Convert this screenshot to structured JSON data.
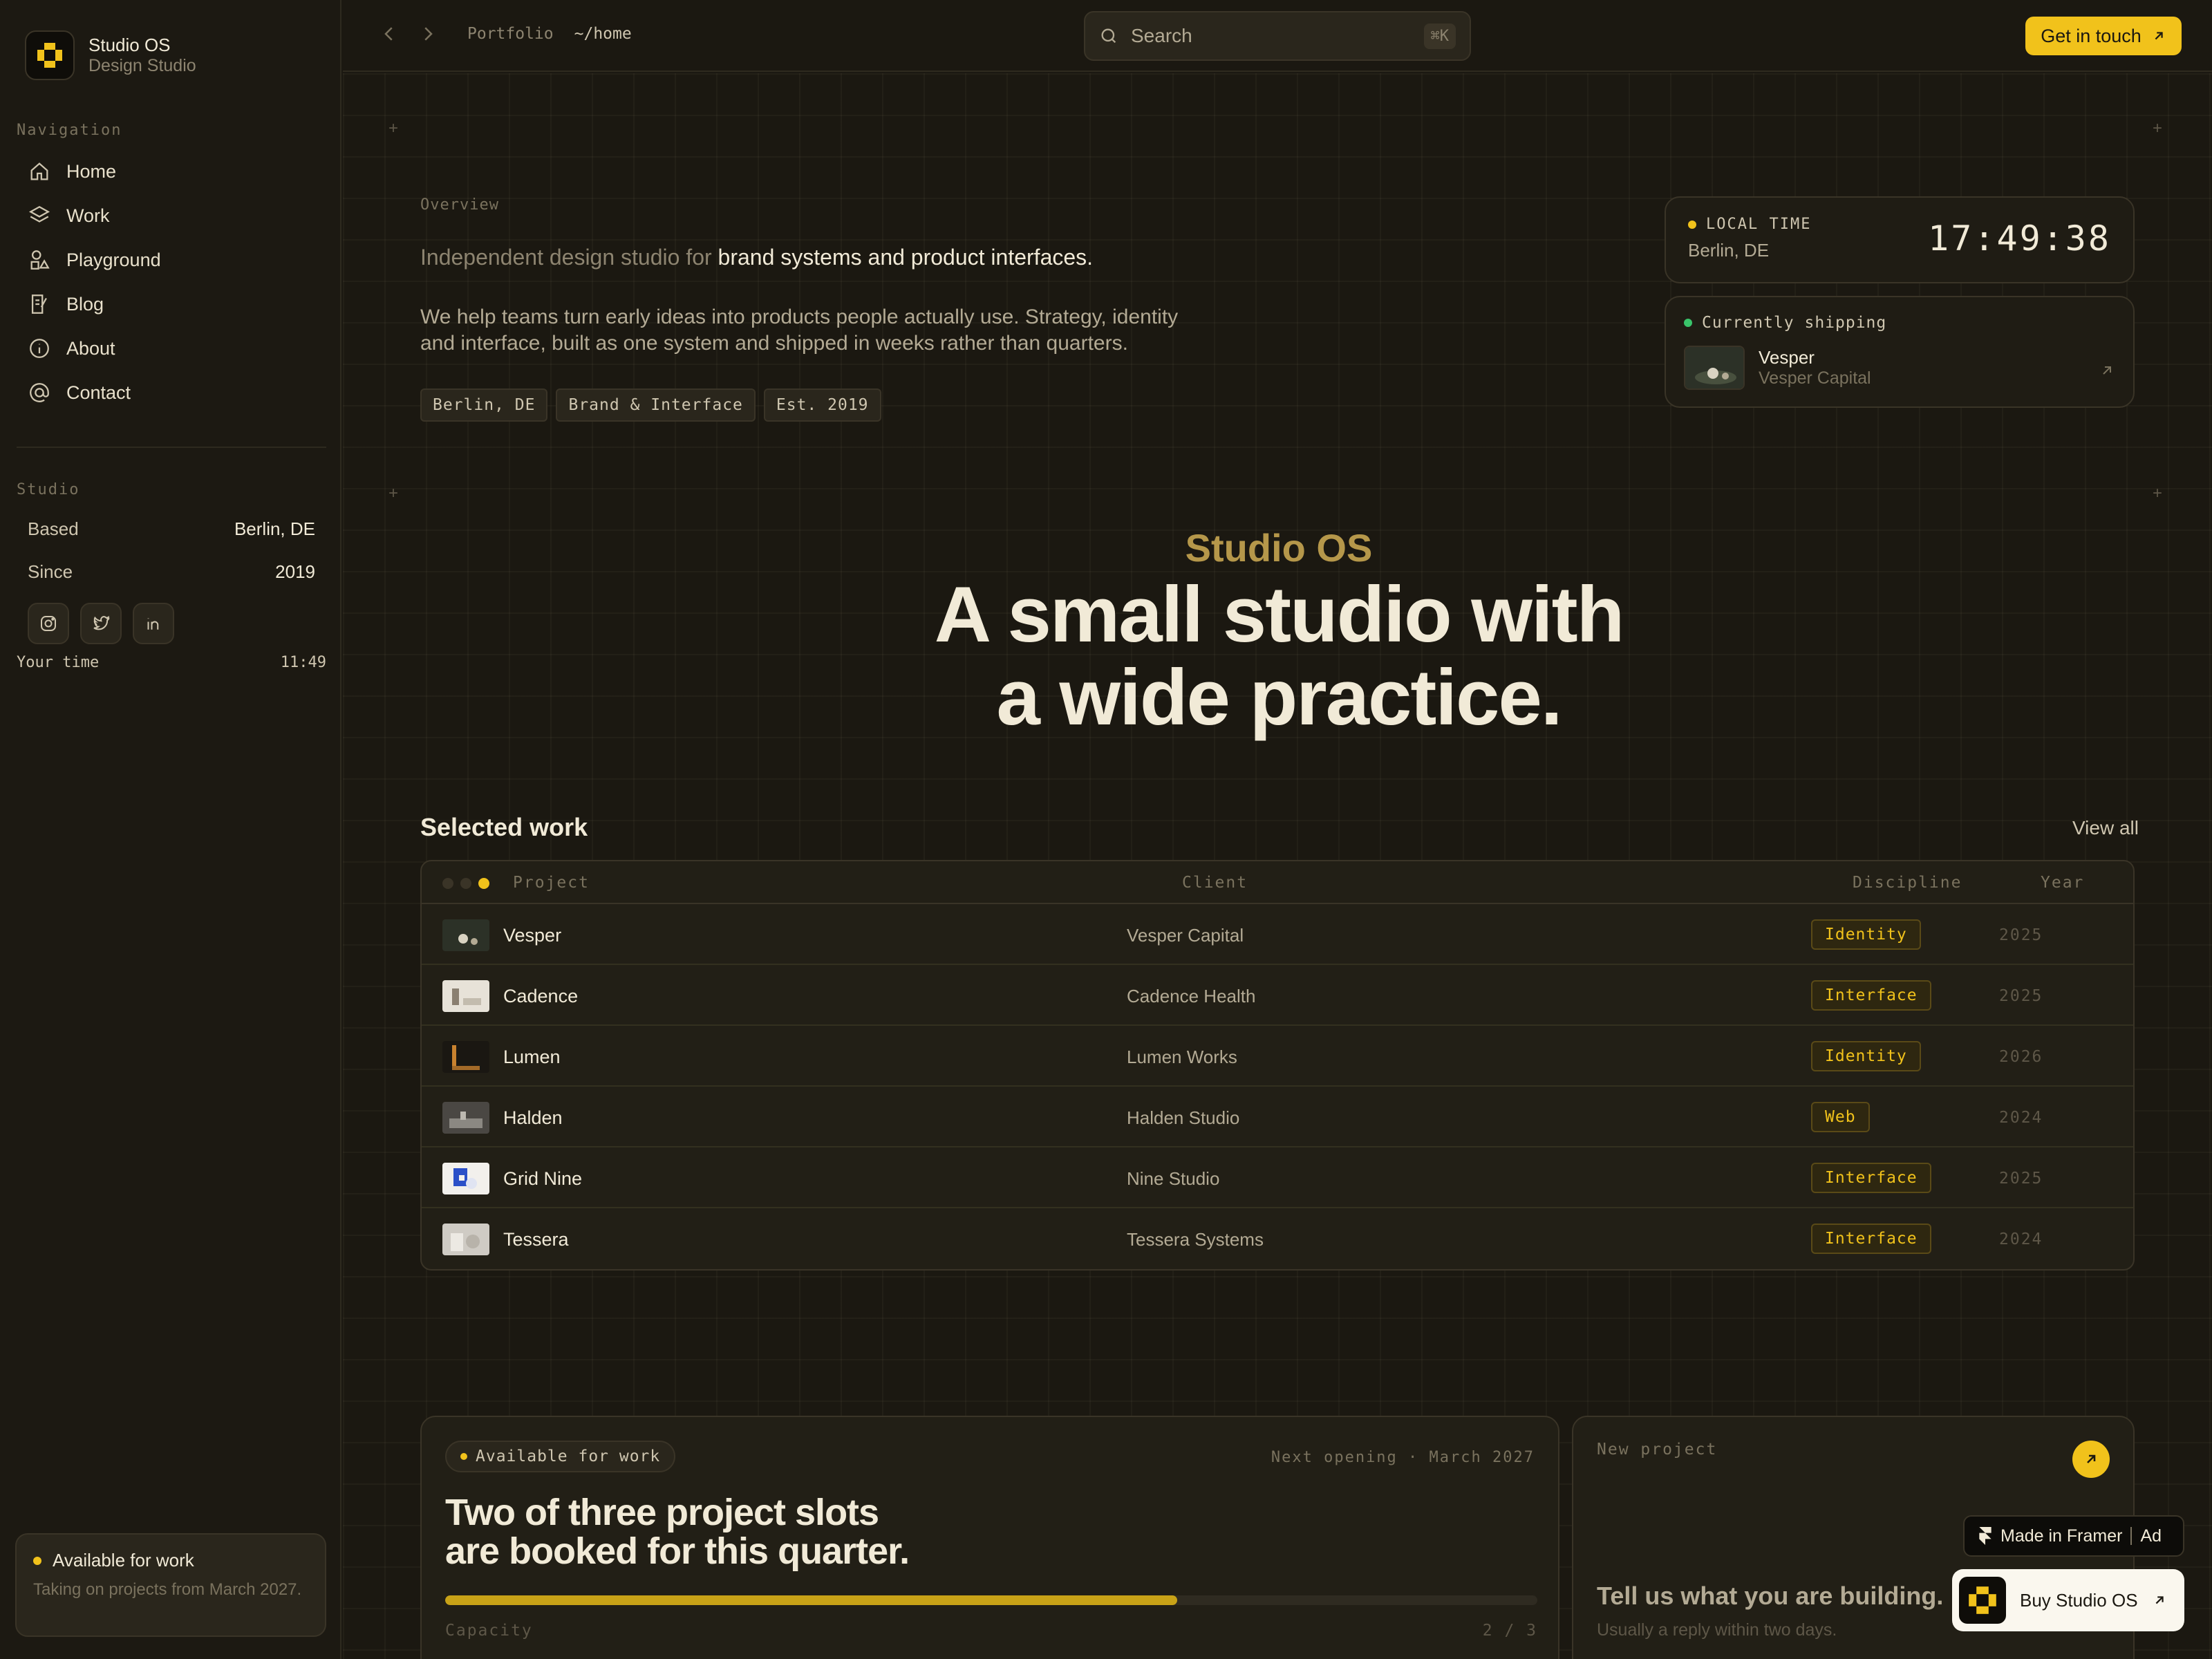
{
  "brand": {
    "name": "Studio OS",
    "subtitle": "Design Studio"
  },
  "sidebar": {
    "nav_label": "Navigation",
    "items": [
      {
        "label": "Home",
        "icon": "home-icon"
      },
      {
        "label": "Work",
        "icon": "layers-icon"
      },
      {
        "label": "Playground",
        "icon": "shapes-icon"
      },
      {
        "label": "Blog",
        "icon": "edit-icon"
      },
      {
        "label": "About",
        "icon": "info-icon"
      },
      {
        "label": "Contact",
        "icon": "at-icon"
      }
    ],
    "studio_label": "Studio",
    "studio_rows": [
      {
        "key": "Based",
        "value": "Berlin, DE"
      },
      {
        "key": "Since",
        "value": "2019"
      }
    ],
    "socials": [
      "instagram-icon",
      "twitter-icon",
      "linkedin-icon"
    ],
    "your_time_label": "Your time",
    "your_time_value": "11:49",
    "availability": {
      "title": "Available for work",
      "text": "Taking on projects from March 2027."
    }
  },
  "topbar": {
    "crumb_root": "Portfolio",
    "crumb_path": "~/home",
    "search_placeholder": "Search",
    "search_shortcut": "⌘K",
    "cta_label": "Get in touch"
  },
  "overview": {
    "label": "Overview",
    "lead_muted": "Independent design studio for",
    "lead_strong": "brand systems and product interfaces.",
    "body": "We help teams turn early ideas into products people actually use. Strategy, identity and interface, built as one system and shipped in weeks rather than quarters.",
    "tags": [
      "Berlin, DE",
      "Brand & Interface",
      "Est. 2019"
    ]
  },
  "local_time": {
    "label": "LOCAL TIME",
    "city": "Berlin, DE",
    "clock": "17:49:38"
  },
  "shipping": {
    "label": "Currently shipping",
    "project": "Vesper",
    "client": "Vesper Capital"
  },
  "hero": {
    "kicker": "Studio OS",
    "line1": "A small studio with",
    "line2": "a wide practice."
  },
  "work": {
    "title": "Selected work",
    "view_all": "View all",
    "columns": {
      "project": "Project",
      "client": "Client",
      "discipline": "Discipline",
      "year": "Year"
    },
    "rows": [
      {
        "project": "Vesper",
        "client": "Vesper Capital",
        "discipline": "Identity",
        "year": "2025"
      },
      {
        "project": "Cadence",
        "client": "Cadence Health",
        "discipline": "Interface",
        "year": "2025"
      },
      {
        "project": "Lumen",
        "client": "Lumen Works",
        "discipline": "Identity",
        "year": "2026"
      },
      {
        "project": "Halden",
        "client": "Halden Studio",
        "discipline": "Web",
        "year": "2024"
      },
      {
        "project": "Grid Nine",
        "client": "Nine Studio",
        "discipline": "Interface",
        "year": "2025"
      },
      {
        "project": "Tessera",
        "client": "Tessera Systems",
        "discipline": "Interface",
        "year": "2024"
      }
    ]
  },
  "capacity": {
    "pill": "Available for work",
    "next_opening": "Next opening · March 2027",
    "headline_1": "Two of three project slots",
    "headline_2": "are booked for this quarter.",
    "label": "Capacity",
    "count": "2 / 3",
    "progress": 0.67
  },
  "new_project": {
    "label": "New project",
    "headline": "Tell us what you are building.",
    "sub": "Usually a reply within two days."
  },
  "badges": {
    "framer": "Made in Framer",
    "ad": "Ad",
    "buy": "Buy Studio OS"
  },
  "colors": {
    "accent": "#f1c21b",
    "background": "#1b1811",
    "status_live": "#39c46a"
  }
}
